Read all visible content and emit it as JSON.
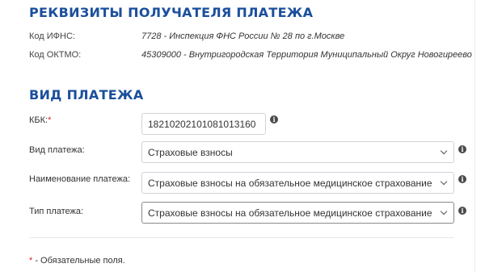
{
  "recipient": {
    "title": "РЕКВИЗИТЫ ПОЛУЧАТЕЛЯ ПЛАТЕЖА",
    "ifns_label": "Код ИФНС:",
    "ifns_value": "7728 - Инспекция ФНС России № 28 по г.Москве",
    "oktmo_label": "Код ОКТМО:",
    "oktmo_value": "45309000 - Внутригородская Территория Муниципальный Округ Новогиреево"
  },
  "payment": {
    "title": "ВИД ПЛАТЕЖА",
    "kbk_label": "КБК:",
    "required_mark": "*",
    "kbk_value": "18210202101081013160",
    "type_label": "Вид платежа:",
    "type_value": "Страховые взносы",
    "name_label": "Наименование платежа:",
    "name_value": "Страховые взносы на обязательное медицинское страхование ра",
    "kind_label": "Тип платежа:",
    "kind_value": "Страховые взносы на обязательное медицинское страхование ра"
  },
  "footnote": {
    "mark": "*",
    "text": " - Обязательные поля."
  }
}
